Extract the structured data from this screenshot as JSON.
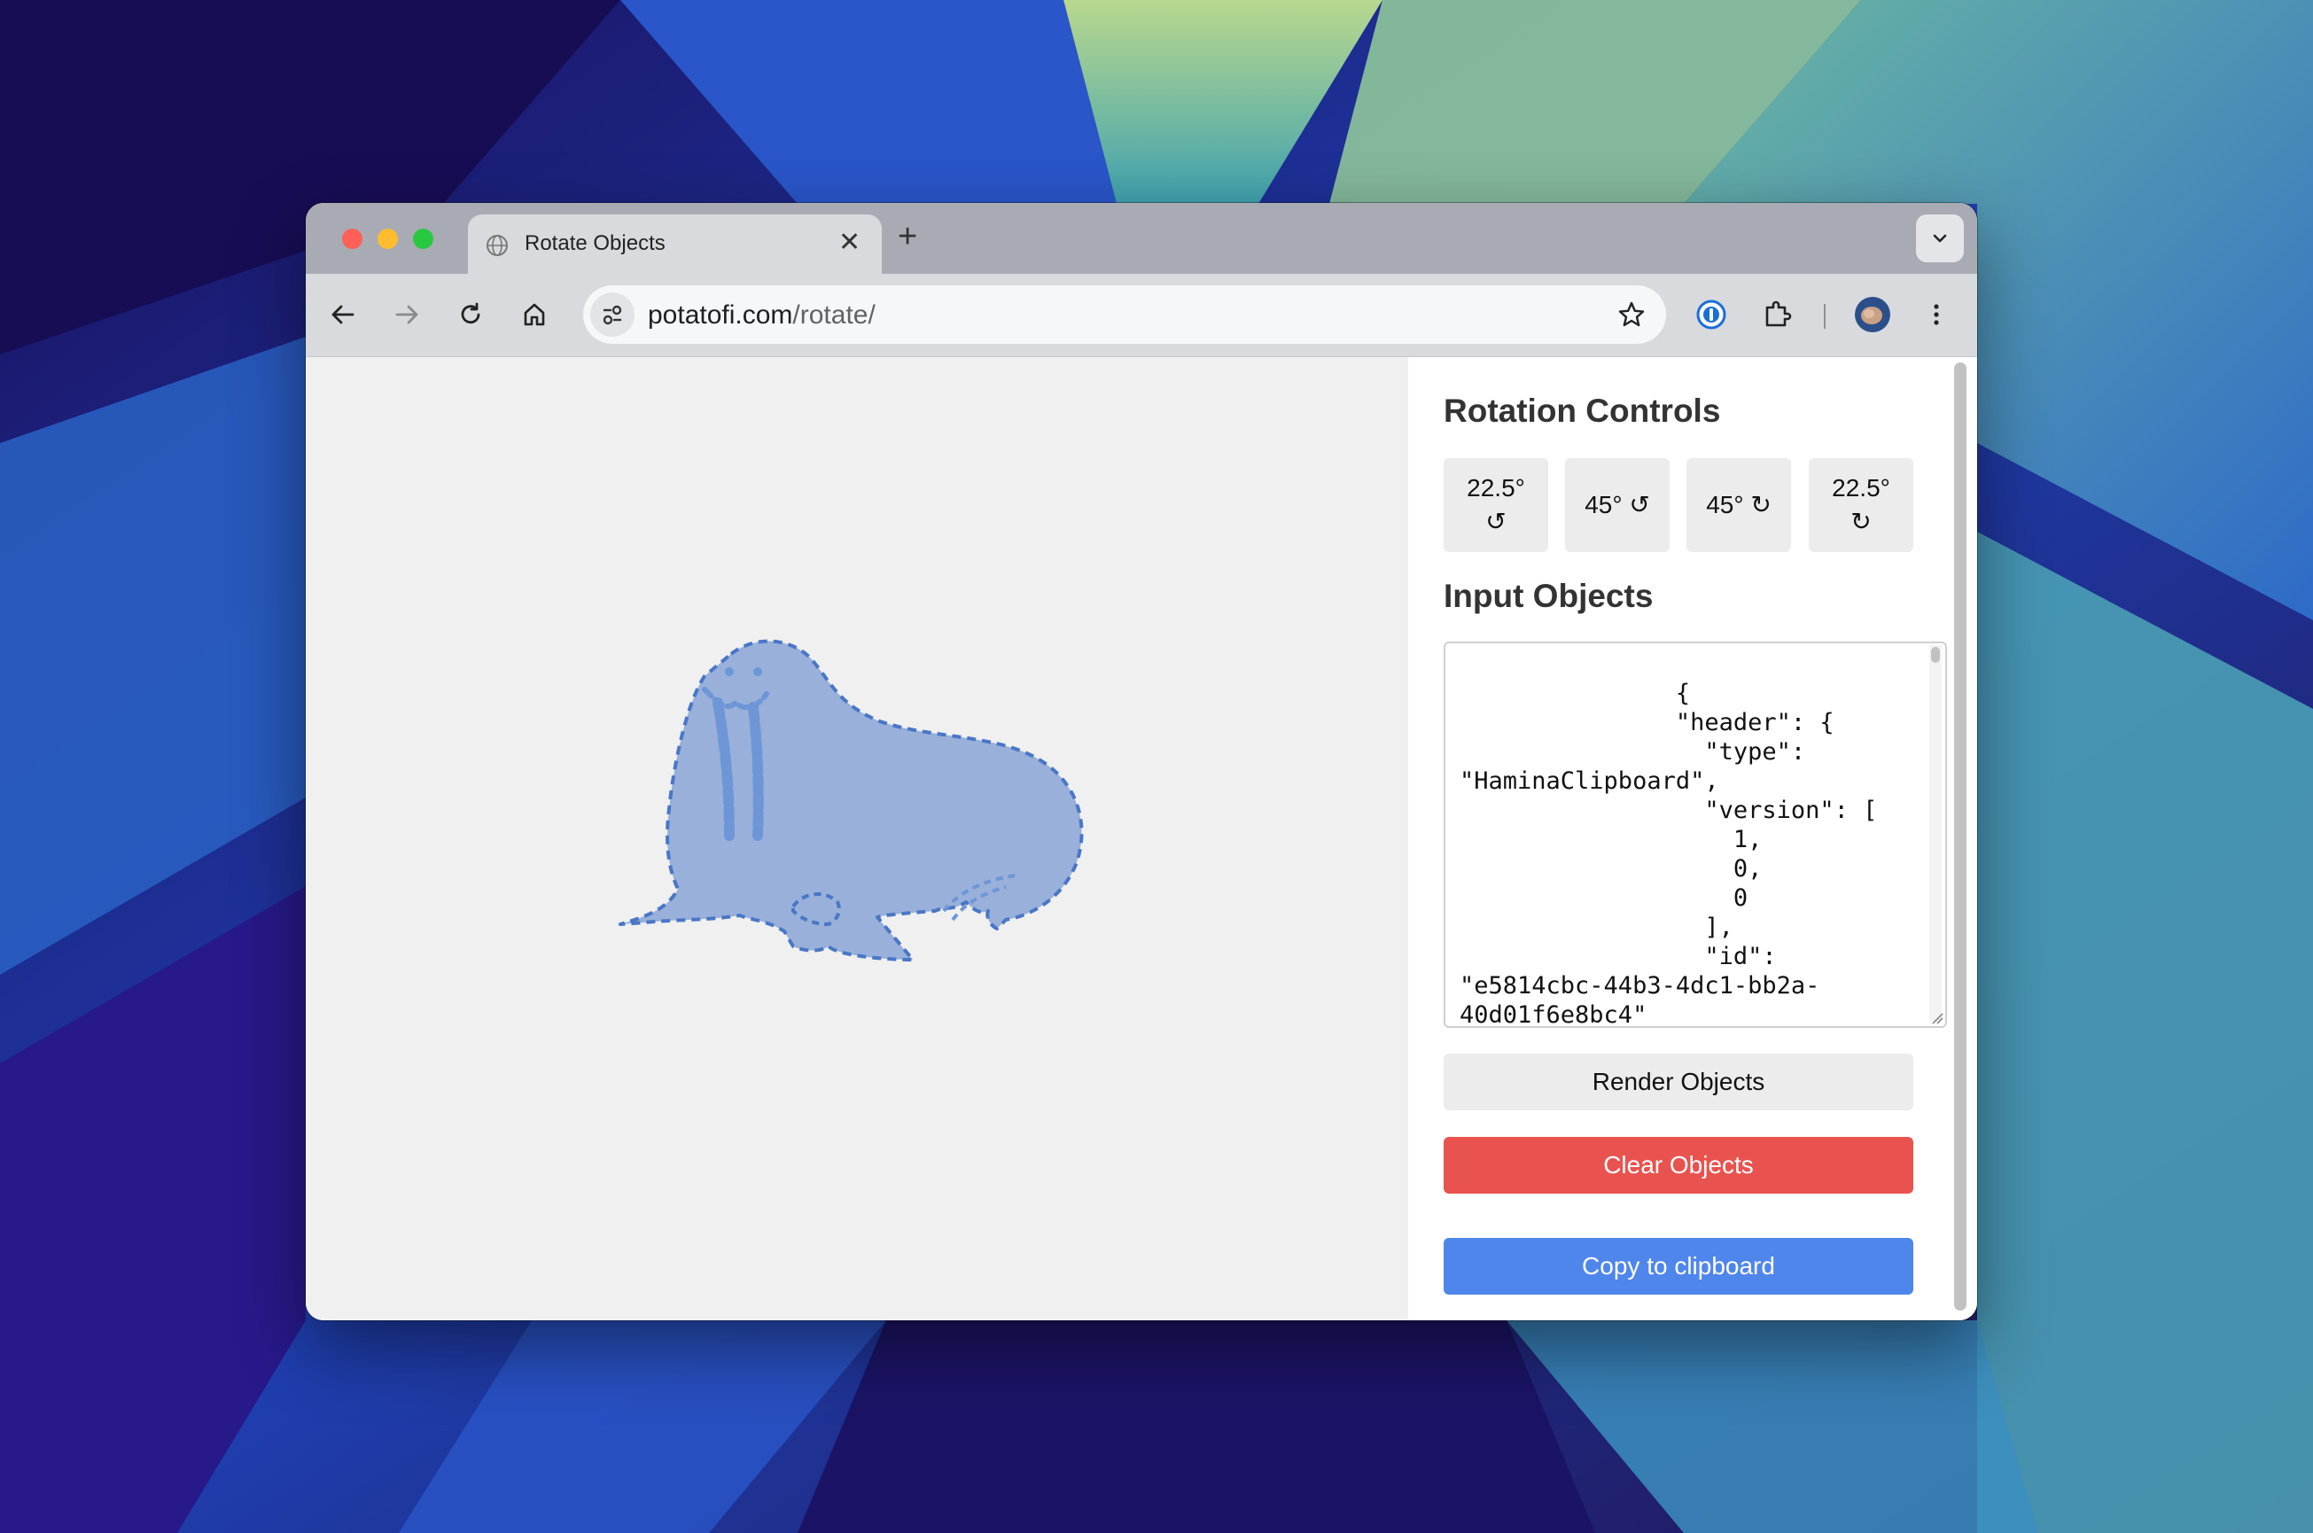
{
  "browser": {
    "tab_title": "Rotate Objects",
    "tab_close": "✕",
    "new_tab": "+",
    "url_host": "potatofi.com",
    "url_path": "/rotate/"
  },
  "panel": {
    "rotation_title": "Rotation Controls",
    "rotation_buttons": [
      {
        "label": "22.5°",
        "symbol": "↺"
      },
      {
        "label": "45° ↺"
      },
      {
        "label": "45° ↻"
      },
      {
        "label": "22.5°",
        "symbol": "↻"
      }
    ],
    "input_title": "Input Objects",
    "input_text": "               {\n               \"header\": {\n                 \"type\":\n\"HaminaClipboard\",\n                 \"version\": [\n                   1,\n                   0,\n                   0\n                 ],\n                 \"id\":\n\"e5814cbc-44b3-4dc1-bb2a-\n40d01f6e8bc4\"",
    "render_label": "Render Objects",
    "clear_label": "Clear Objects",
    "copy_label": "Copy to clipboard"
  },
  "colors": {
    "clear_button": "#e9534f",
    "copy_button": "#4f86ec",
    "walrus_fill": "#98b0da",
    "walrus_stroke": "#4a76c6"
  }
}
